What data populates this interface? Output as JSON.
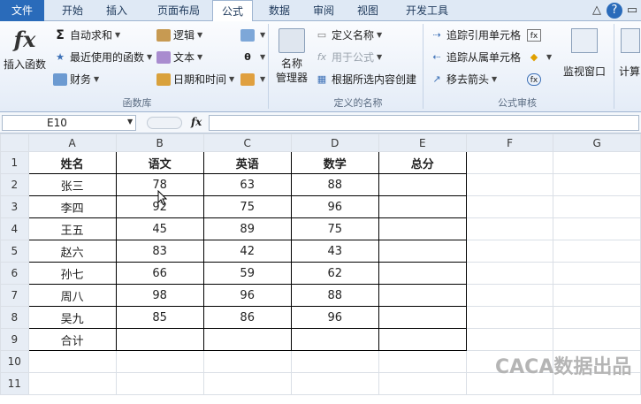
{
  "tabs": [
    "文件",
    "开始",
    "插入",
    "页面布局",
    "公式",
    "数据",
    "审阅",
    "视图",
    "开发工具"
  ],
  "ribbon": {
    "insert_function": "插入函数",
    "autosum": "自动求和",
    "recent": "最近使用的函数",
    "financial": "财务",
    "logical": "逻辑",
    "text": "文本",
    "datetime": "日期和时间",
    "group1_label": "函数库",
    "name_manager_1": "名称",
    "name_manager_2": "管理器",
    "define_name": "定义名称",
    "use_in_formula": "用于公式",
    "create_from_sel": "根据所选内容创建",
    "group2_label": "定义的名称",
    "trace_precedents": "追踪引用单元格",
    "trace_dependents": "追踪从属单元格",
    "remove_arrows": "移去箭头",
    "group3_label": "公式审核",
    "watch_window": "监视窗口",
    "calc": "计算"
  },
  "formula_bar": {
    "name_box": "E10",
    "fx": "fx",
    "value": ""
  },
  "columns": [
    "A",
    "B",
    "C",
    "D",
    "E",
    "F",
    "G"
  ],
  "rows": [
    "1",
    "2",
    "3",
    "4",
    "5",
    "6",
    "7",
    "8",
    "9",
    "10",
    "11"
  ],
  "table": {
    "header": [
      "姓名",
      "语文",
      "英语",
      "数学",
      "总分"
    ],
    "data": [
      [
        "张三",
        "78",
        "63",
        "88",
        ""
      ],
      [
        "李四",
        "92",
        "75",
        "96",
        ""
      ],
      [
        "王五",
        "45",
        "89",
        "75",
        ""
      ],
      [
        "赵六",
        "83",
        "42",
        "43",
        ""
      ],
      [
        "孙七",
        "66",
        "59",
        "62",
        ""
      ],
      [
        "周八",
        "98",
        "96",
        "88",
        ""
      ],
      [
        "吴九",
        "85",
        "86",
        "96",
        ""
      ],
      [
        "合计",
        "",
        "",
        "",
        ""
      ]
    ]
  },
  "watermark": "CACA数据出品"
}
